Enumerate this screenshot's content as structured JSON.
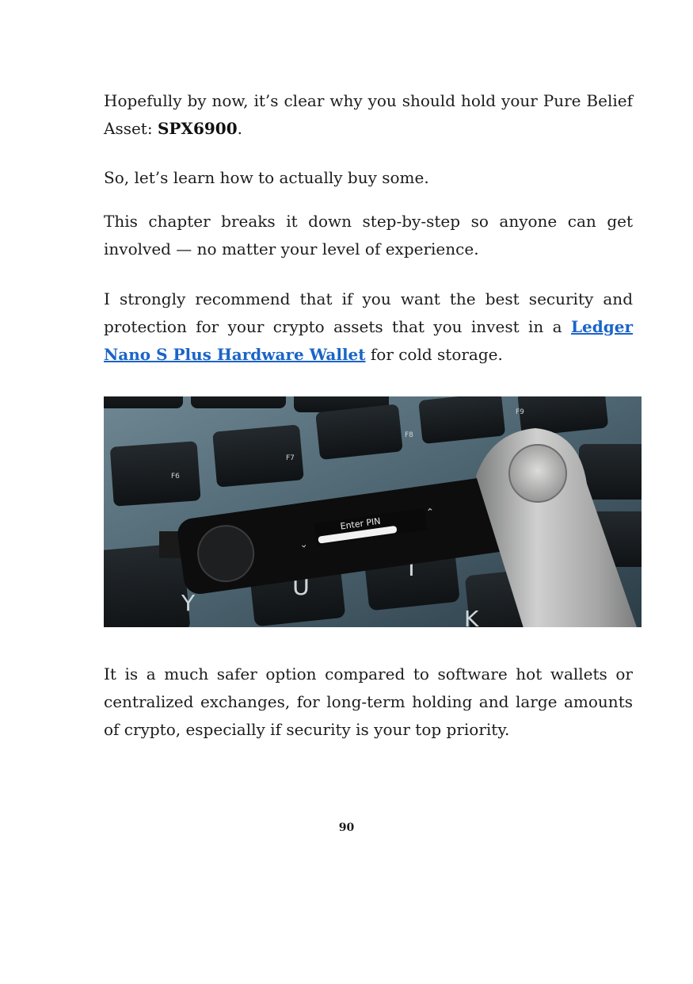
{
  "paragraphs": {
    "p1_before": "Hopefully by now, it’s clear why you should hold your Pure Belief Asset: ",
    "p1_bold": "SPX6900",
    "p1_after": ".",
    "p2": "So, let’s learn how to actually buy some.",
    "p3": "This chapter breaks it down step-by-step so anyone can get involved — no matter your level of experience.",
    "p4_before": "I strongly recommend that if you want the best security and protection for your crypto assets that you invest in a ",
    "p4_link": "Ledger Nano S Plus Hardware Wallet",
    "p4_after": " for cold storage.",
    "p5": "It is a much safer option compared to software hot wallets or centralized exchanges, for long-term holding and large amounts of crypto, especially if security is your top priority."
  },
  "photo": {
    "screen_text": "Enter PIN",
    "keys": {
      "f6": "F6",
      "f7": "F7",
      "f8": "F8",
      "f9": "F9",
      "y": "Y",
      "u": "U",
      "i": "I",
      "k": "K"
    }
  },
  "page_number": "90",
  "colors": {
    "link": "#1a64c8",
    "text": "#1c1c1c"
  }
}
